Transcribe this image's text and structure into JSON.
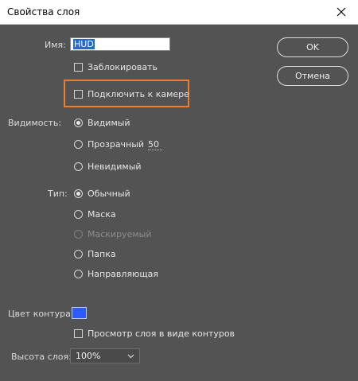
{
  "window": {
    "title": "Свойства слоя"
  },
  "form": {
    "name_label": "Имя:",
    "name_value": "HUD",
    "lock_label": "Заблокировать",
    "attach_camera_label": "Подключить к камере",
    "visibility_label": "Видимость:",
    "visibility_options": {
      "visible": "Видимый",
      "transparent": "Прозрачный",
      "invisible": "Невидимый"
    },
    "transparency_value": "50",
    "type_label": "Тип:",
    "type_options": {
      "normal": "Обычный",
      "mask": "Маска",
      "masked": "Маскируемый",
      "folder": "Папка",
      "guide": "Направляющая"
    },
    "outline_color_label": "Цвет контура:",
    "outline_color": "#2d5bff",
    "outline_view_label": "Просмотр слоя в виде контуров",
    "layer_height_label": "Высота слоя:",
    "layer_height_value": "100%"
  },
  "buttons": {
    "ok": "OK",
    "cancel": "Отмена"
  },
  "colors": {
    "highlight": "#ee7d2e",
    "background": "#535353"
  }
}
